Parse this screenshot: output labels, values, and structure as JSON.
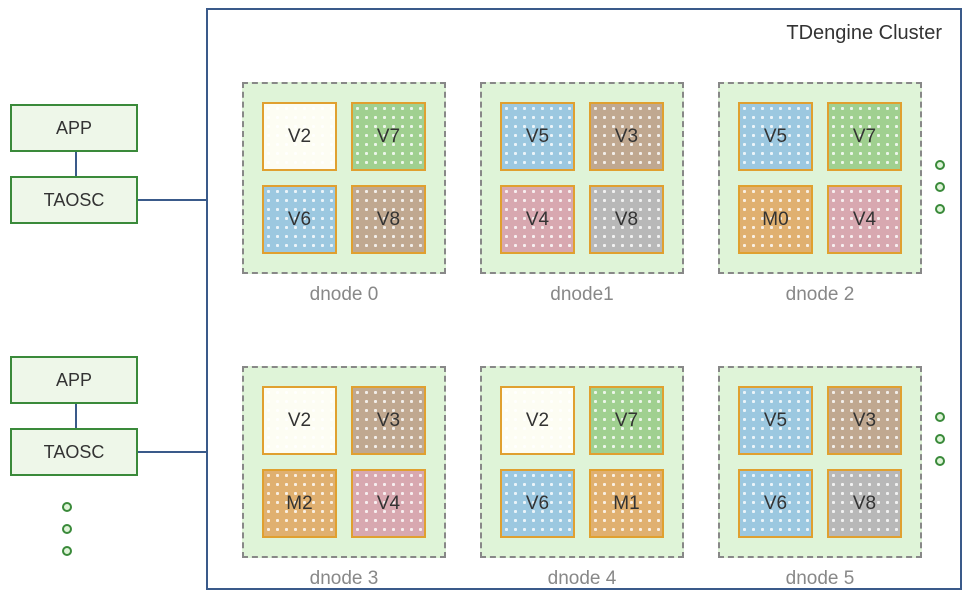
{
  "cluster_title": "TDengine Cluster",
  "clients": [
    {
      "app_label": "APP",
      "driver_label": "TAOSC"
    },
    {
      "app_label": "APP",
      "driver_label": "TAOSC"
    }
  ],
  "dnodes": [
    {
      "label": "dnode 0",
      "nodes": [
        {
          "name": "V2",
          "color": "white"
        },
        {
          "name": "V7",
          "color": "green"
        },
        {
          "name": "V6",
          "color": "blue"
        },
        {
          "name": "V8",
          "color": "brown"
        }
      ]
    },
    {
      "label": "dnode1",
      "nodes": [
        {
          "name": "V5",
          "color": "blue"
        },
        {
          "name": "V3",
          "color": "brown"
        },
        {
          "name": "V4",
          "color": "pink"
        },
        {
          "name": "V8",
          "color": "gray"
        }
      ]
    },
    {
      "label": "dnode 2",
      "nodes": [
        {
          "name": "V5",
          "color": "blue"
        },
        {
          "name": "V7",
          "color": "green"
        },
        {
          "name": "M0",
          "color": "orange"
        },
        {
          "name": "V4",
          "color": "pink"
        }
      ]
    },
    {
      "label": "dnode 3",
      "nodes": [
        {
          "name": "V2",
          "color": "white"
        },
        {
          "name": "V3",
          "color": "brown"
        },
        {
          "name": "M2",
          "color": "orange"
        },
        {
          "name": "V4",
          "color": "pink"
        }
      ]
    },
    {
      "label": "dnode 4",
      "nodes": [
        {
          "name": "V2",
          "color": "white"
        },
        {
          "name": "V7",
          "color": "green"
        },
        {
          "name": "V6",
          "color": "blue"
        },
        {
          "name": "M1",
          "color": "orange"
        }
      ]
    },
    {
      "label": "dnode 5",
      "nodes": [
        {
          "name": "V5",
          "color": "blue"
        },
        {
          "name": "V3",
          "color": "brown"
        },
        {
          "name": "V6",
          "color": "blue"
        },
        {
          "name": "V8",
          "color": "gray"
        }
      ]
    }
  ]
}
